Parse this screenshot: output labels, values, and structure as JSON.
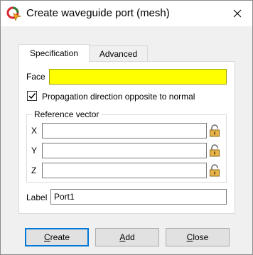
{
  "window": {
    "title": "Create waveguide port (mesh)"
  },
  "icons": {
    "app": "app-logo-icon",
    "close": "close-icon",
    "lock": "lock-icon",
    "check": "checkmark-icon"
  },
  "colors": {
    "face_highlight": "#ffff00",
    "default_button_border": "#0078d7"
  },
  "tabs": [
    {
      "label": "Specification",
      "active": true
    },
    {
      "label": "Advanced",
      "active": false
    }
  ],
  "form": {
    "face_label": "Face",
    "face_value": "",
    "propagation_label": "Propagation direction opposite to normal",
    "propagation_checked": true,
    "reference_vector": {
      "title": "Reference vector",
      "x_label": "X",
      "x_value": "",
      "y_label": "Y",
      "y_value": "",
      "z_label": "Z",
      "z_value": ""
    },
    "label_label": "Label",
    "label_value": "Port1"
  },
  "buttons": {
    "create_first": "C",
    "create_rest": "reate",
    "add_first": "A",
    "add_rest": "dd",
    "close_first": "C",
    "close_rest": "lose"
  }
}
